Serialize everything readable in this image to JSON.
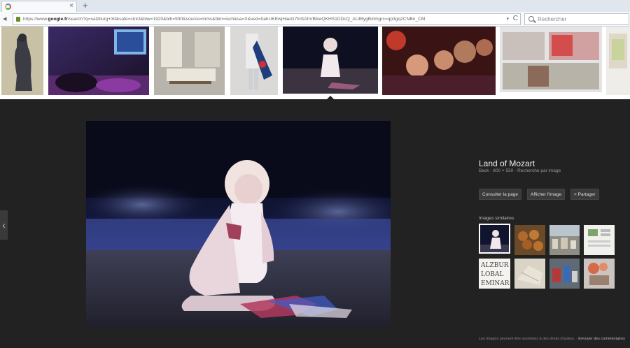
{
  "browser": {
    "tab_title": "",
    "tab_close": "×",
    "new_tab": "+",
    "url_prefix": "https://www.",
    "url_domain": "google.fr",
    "url_rest": "/search?q=salzburg+3d&safe=strict&biw=1920&bih=930&source=lnms&tbm=isch&sa=X&ved=0ahUKEwjHaeG7fnSAhVBbwQKHS1DDcQ_AUIBygB#imgrc=qp3gq2CNBn_CM",
    "reload": "C",
    "search_placeholder": "Rechercher"
  },
  "result": {
    "title": "Land of Mozart",
    "subtitle": "Back - 800 × 550 - Recherche par image",
    "buttons": [
      "Consulter la page",
      "Afficher l'image",
      "Partager"
    ],
    "similar_label": "Images similaires",
    "footer_text": "Les images peuvent être soumises à des droits d'auteur.",
    "footer_link": "Envoyer des commentaires"
  },
  "navigation": {
    "prev_arrow": "‹"
  }
}
